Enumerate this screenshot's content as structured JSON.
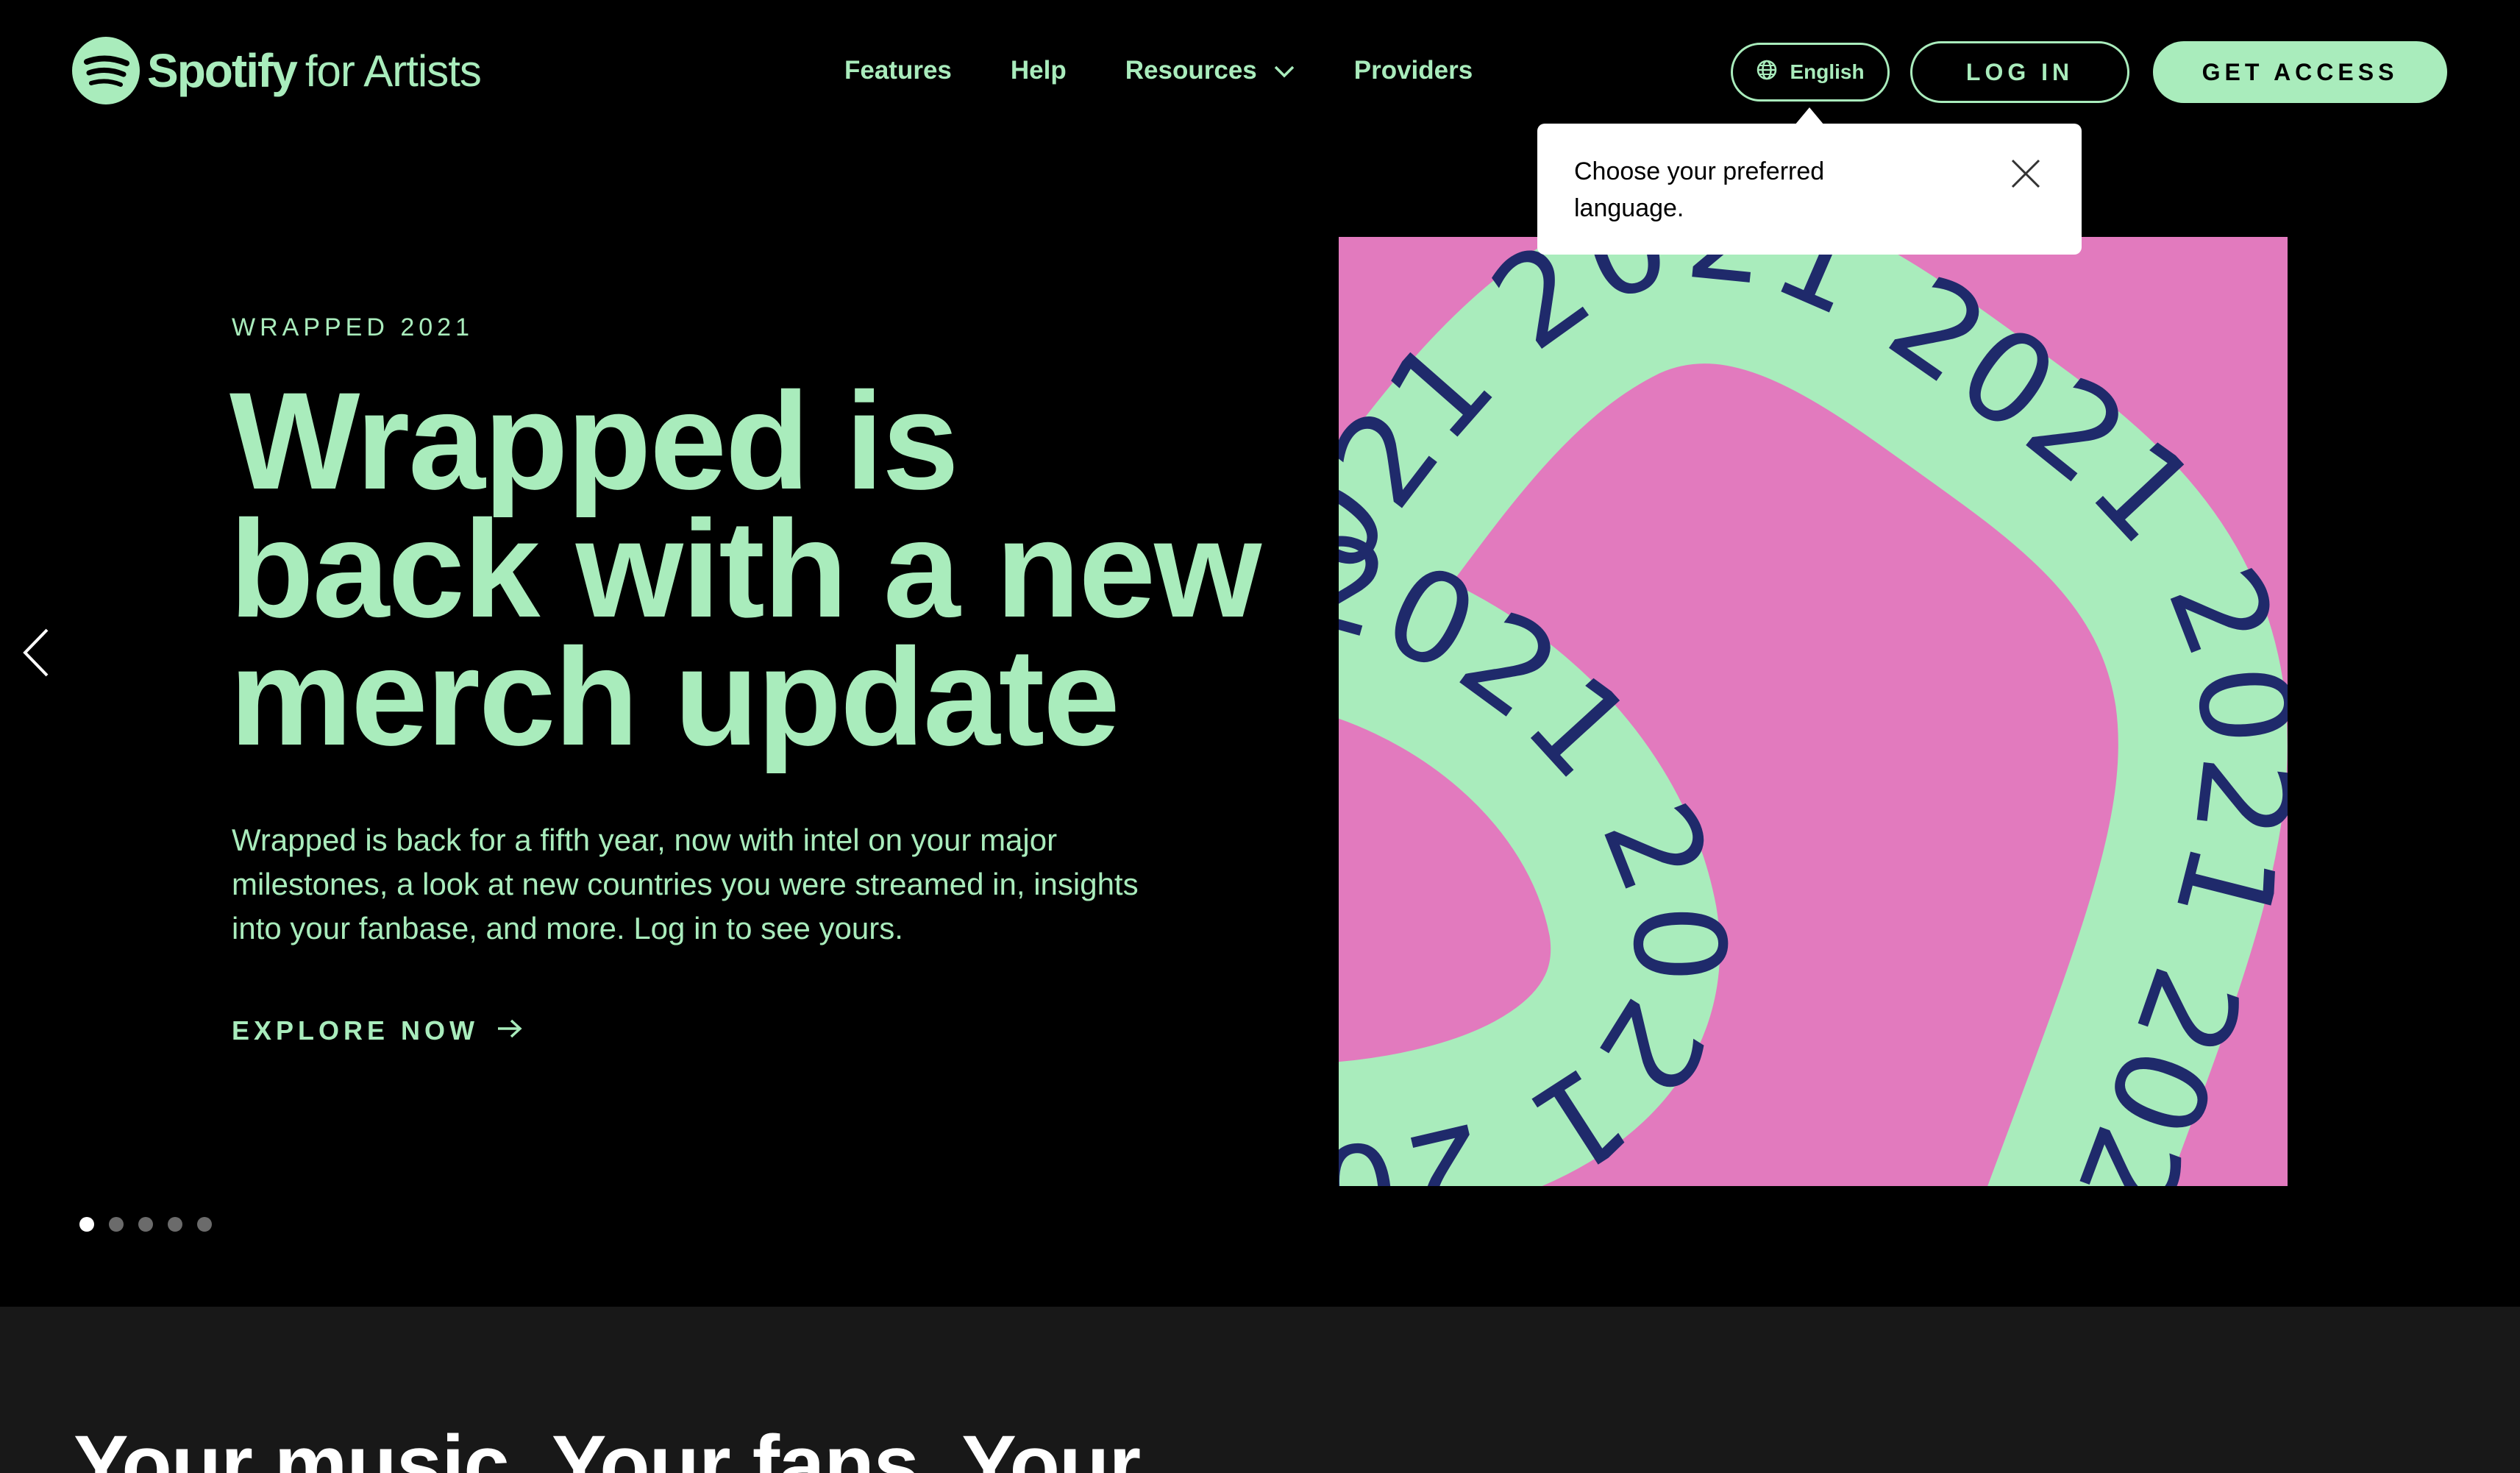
{
  "header": {
    "logo_brand": "Spotify",
    "logo_suffix": "for Artists",
    "nav": [
      {
        "label": "Features"
      },
      {
        "label": "Help"
      },
      {
        "label": "Resources"
      },
      {
        "label": "Providers"
      }
    ],
    "language_button": "English",
    "login_button": "LOG IN",
    "get_access_button": "GET ACCESS"
  },
  "tooltip": {
    "text": "Choose your preferred language."
  },
  "hero": {
    "eyebrow": "WRAPPED 2021",
    "title": "Wrapped is back with a new merch update",
    "body": "Wrapped is back for a fifth year, now with intel on your major milestones, a look at new countries you were streamed in, insights into your fanbase, and more. Log in to see yours.",
    "cta": "EXPLORE NOW",
    "artwork_text": "2021",
    "carousel": {
      "total_slides": 5,
      "active_slide": 1
    }
  },
  "band": {
    "heading": "Your music. Your fans. Your"
  },
  "colors": {
    "accent": "#a9ecbc",
    "background": "#000000",
    "band_background": "#181818",
    "artwork_pink": "#e27abe",
    "artwork_navy": "#1f2a6b"
  },
  "icons": {
    "logo": "spotify-logo-icon",
    "globe": "globe-icon",
    "chevron": "chevron-down-icon",
    "close": "close-icon",
    "arrow": "arrow-right-icon",
    "prev": "chevron-left-icon"
  }
}
